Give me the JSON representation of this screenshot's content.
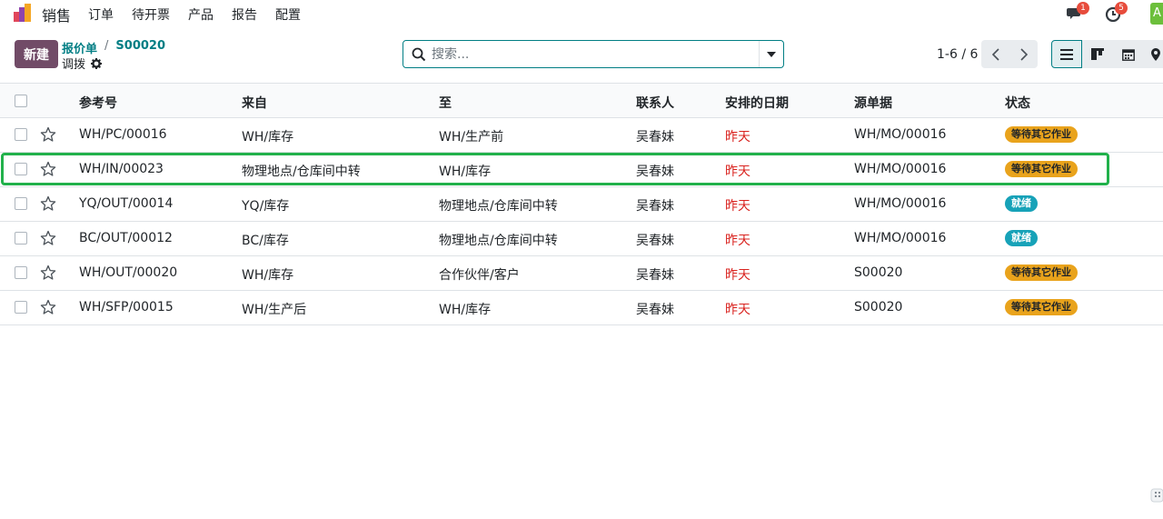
{
  "topbar": {
    "app_name": "销售",
    "menu": [
      "订单",
      "待开票",
      "产品",
      "报告",
      "配置"
    ],
    "chat_badge": "1",
    "activity_badge": "5",
    "avatar_letter": "A"
  },
  "control": {
    "new_label": "新建",
    "breadcrumb": [
      "报价单",
      "S00020"
    ],
    "subtitle": "调拨",
    "search_placeholder": "搜索...",
    "pager": "1-6 / 6"
  },
  "table": {
    "headers": [
      "参考号",
      "来自",
      "至",
      "联系人",
      "安排的日期",
      "源单据",
      "状态"
    ],
    "rows": [
      {
        "ref": "WH/PC/00016",
        "from": "WH/库存",
        "to": "WH/生产前",
        "contact": "吴春妹",
        "date": "昨天",
        "source": "WH/MO/00016",
        "status": "等待其它作业",
        "status_type": "waiting"
      },
      {
        "ref": "WH/IN/00023",
        "from": "物理地点/仓库间中转",
        "to": "WH/库存",
        "contact": "吴春妹",
        "date": "昨天",
        "source": "WH/MO/00016",
        "status": "等待其它作业",
        "status_type": "waiting"
      },
      {
        "ref": "YQ/OUT/00014",
        "from": "YQ/库存",
        "to": "物理地点/仓库间中转",
        "contact": "吴春妹",
        "date": "昨天",
        "source": "WH/MO/00016",
        "status": "就绪",
        "status_type": "ready"
      },
      {
        "ref": "BC/OUT/00012",
        "from": "BC/库存",
        "to": "物理地点/仓库间中转",
        "contact": "吴春妹",
        "date": "昨天",
        "source": "WH/MO/00016",
        "status": "就绪",
        "status_type": "ready"
      },
      {
        "ref": "WH/OUT/00020",
        "from": "WH/库存",
        "to": "合作伙伴/客户",
        "contact": "吴春妹",
        "date": "昨天",
        "source": "S00020",
        "status": "等待其它作业",
        "status_type": "waiting"
      },
      {
        "ref": "WH/SFP/00015",
        "from": "WH/生产后",
        "to": "WH/库存",
        "contact": "吴春妹",
        "date": "昨天",
        "source": "S00020",
        "status": "等待其它作业",
        "status_type": "waiting"
      }
    ]
  },
  "colors": {
    "brand": "#714b67",
    "link": "#017e84",
    "date_red": "#d9231f",
    "badge_waiting": "#e9a31c",
    "badge_ready": "#17a2b8",
    "highlight": "#21b14b"
  }
}
